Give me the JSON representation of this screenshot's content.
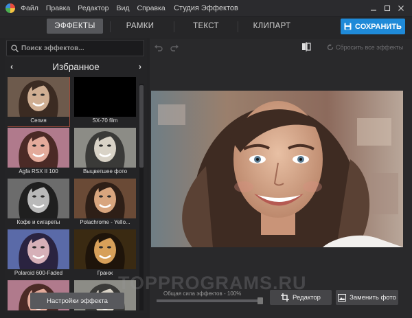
{
  "app": {
    "title": "Студия Эффектов",
    "menu": [
      "Файл",
      "Правка",
      "Редактор",
      "Вид",
      "Справка"
    ]
  },
  "tabs": [
    {
      "label": "ЭФФЕКТЫ",
      "active": true
    },
    {
      "label": "РАМКИ",
      "active": false
    },
    {
      "label": "ТЕКСТ",
      "active": false
    },
    {
      "label": "КЛИПАРТ",
      "active": false
    }
  ],
  "save_label": "СОХРАНИТЬ",
  "search": {
    "placeholder": "Поиск эффектов..."
  },
  "category": "Избранное",
  "effects": [
    {
      "label": "Сепия",
      "selected": true,
      "style": "sepia"
    },
    {
      "label": "SX-70 film",
      "selected": false,
      "style": "black"
    },
    {
      "label": "Agfa RSX II 100",
      "selected": false,
      "style": "pink"
    },
    {
      "label": "Выцветшее фото",
      "selected": false,
      "style": "faded"
    },
    {
      "label": "Кофе и сигареты",
      "selected": false,
      "style": "bw"
    },
    {
      "label": "Polachrome - Yello...",
      "selected": false,
      "style": "warm"
    },
    {
      "label": "Polaroid 600-Faded",
      "selected": false,
      "style": "blue"
    },
    {
      "label": "Гранж",
      "selected": false,
      "style": "grunge"
    },
    {
      "label": "",
      "selected": false,
      "style": "pink"
    },
    {
      "label": "",
      "selected": false,
      "style": "faded"
    }
  ],
  "settings_label": "Настройки эффекта",
  "reset_label": "Сбросить все эффекты",
  "strength_label": "Общая сила эффектов - 100%",
  "strength_value": 1.0,
  "editor_label": "Редактор",
  "replace_label": "Заменить фото",
  "watermark": "TOPPROGRAMS.RU",
  "colors": {
    "accent": "#1f8ad8",
    "background": "#232325",
    "selected_outline": "#a04a3a"
  }
}
